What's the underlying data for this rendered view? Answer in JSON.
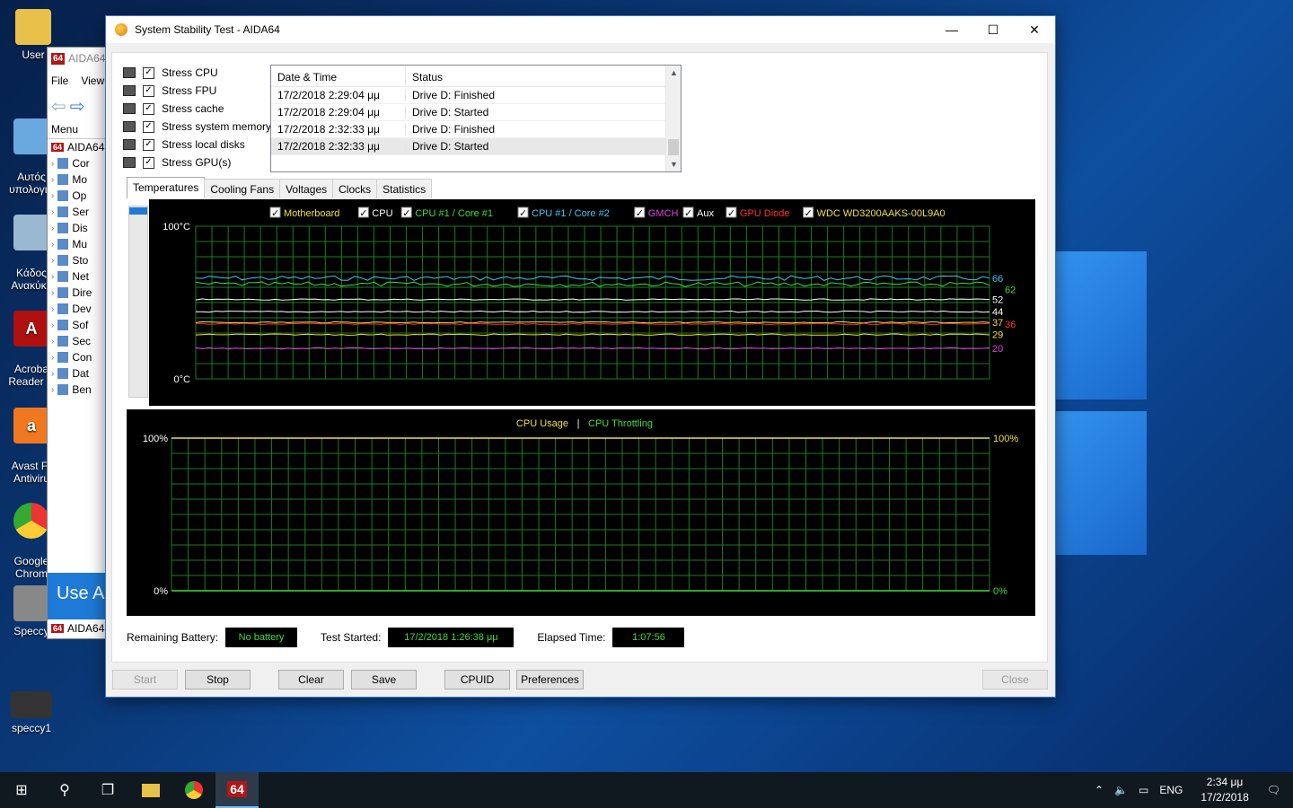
{
  "desktop": {
    "icons": [
      {
        "label": "User"
      },
      {
        "label": "Αυτός\nυπολογισ"
      },
      {
        "label": "Κάδος\nΑνακύκλ"
      },
      {
        "label": "Acroba\nReader D"
      },
      {
        "label": "Avast Fr\nAntiviru"
      },
      {
        "label": "Google\nChrom"
      },
      {
        "label": "Speccy"
      },
      {
        "label": "speccy1"
      }
    ]
  },
  "bg_window": {
    "title": "AIDA64",
    "menu": [
      "File",
      "View"
    ],
    "menu_tab": "Menu",
    "tree_root": "AIDA64",
    "tree_items": [
      "Cor",
      "Mo",
      "Op",
      "Ser",
      "Dis",
      "Mu",
      "Sto",
      "Net",
      "Dire",
      "Dev",
      "Sof",
      "Sec",
      "Con",
      "Dat",
      "Ben"
    ],
    "banner": "Use A",
    "taskbar_label": "AIDA64"
  },
  "window": {
    "title": "System Stability Test - AIDA64",
    "controls": {
      "minimize": "—",
      "maximize": "☐",
      "close": "✕"
    }
  },
  "stress": [
    {
      "label": "Stress CPU",
      "checked": true
    },
    {
      "label": "Stress FPU",
      "checked": true
    },
    {
      "label": "Stress cache",
      "checked": true
    },
    {
      "label": "Stress system memory",
      "checked": true
    },
    {
      "label": "Stress local disks",
      "checked": true
    },
    {
      "label": "Stress GPU(s)",
      "checked": true
    }
  ],
  "log": {
    "headers": [
      "Date & Time",
      "Status"
    ],
    "rows": [
      {
        "time": "17/2/2018 2:29:04 μμ",
        "status": "Drive D: Finished"
      },
      {
        "time": "17/2/2018 2:29:04 μμ",
        "status": "Drive D: Started"
      },
      {
        "time": "17/2/2018 2:32:33 μμ",
        "status": "Drive D: Finished"
      },
      {
        "time": "17/2/2018 2:32:33 μμ",
        "status": "Drive D: Started"
      }
    ]
  },
  "tabs": [
    "Temperatures",
    "Cooling Fans",
    "Voltages",
    "Clocks",
    "Statistics"
  ],
  "chart_data": [
    {
      "type": "line",
      "title": "",
      "legend": [
        {
          "name": "Motherboard",
          "color": "#f0e040"
        },
        {
          "name": "CPU",
          "color": "#ffffff"
        },
        {
          "name": "CPU #1 / Core #1",
          "color": "#3fdc3f"
        },
        {
          "name": "CPU #1 / Core #2",
          "color": "#40c8f0"
        },
        {
          "name": "GMCH",
          "color": "#e040e0"
        },
        {
          "name": "Aux",
          "color": "#ffffff"
        },
        {
          "name": "GPU Diode",
          "color": "#ff3030"
        },
        {
          "name": "WDC WD3200AAKS-00L9A0",
          "color": "#f0e040"
        }
      ],
      "ylim": [
        0,
        100
      ],
      "y_top_label": "100°C",
      "y_bottom_label": "0°C",
      "series": [
        {
          "name": "CPU #1 / Core #2",
          "value": 66,
          "color": "#40c8f0"
        },
        {
          "name": "CPU #1 / Core #1",
          "value": 62,
          "color": "#3fdc3f"
        },
        {
          "name": "CPU",
          "value": 52,
          "color": "#ffffff"
        },
        {
          "name": "Aux",
          "value": 44,
          "color": "#ffffff"
        },
        {
          "name": "WDC WD3200AAKS-00L9A0",
          "value": 37,
          "color": "#f0e040"
        },
        {
          "name": "GPU Diode",
          "value": 36,
          "color": "#ff3030"
        },
        {
          "name": "Motherboard",
          "value": 29,
          "color": "#f0e040"
        },
        {
          "name": "GMCH",
          "value": 20,
          "color": "#e040e0"
        }
      ],
      "grid": true
    },
    {
      "type": "line",
      "legend": [
        {
          "name": "CPU Usage",
          "color": "#f0e040"
        },
        {
          "name": "CPU Throttling",
          "color": "#3fdc3f"
        }
      ],
      "separator": "|",
      "ylim": [
        0,
        100
      ],
      "left_top_label": "100%",
      "left_bottom_label": "0%",
      "right_top_label": "100%",
      "right_bottom_label": "0%",
      "series": [
        {
          "name": "CPU Usage",
          "value": 100,
          "color": "#f0e040"
        },
        {
          "name": "CPU Throttling",
          "value": 0,
          "color": "#3fdc3f"
        }
      ],
      "grid": true
    }
  ],
  "status": {
    "battery_label": "Remaining Battery:",
    "battery_value": "No battery",
    "started_label": "Test Started:",
    "started_value": "17/2/2018 1:26:38 μμ",
    "elapsed_label": "Elapsed Time:",
    "elapsed_value": "1:07:56"
  },
  "buttons": {
    "start": "Start",
    "stop": "Stop",
    "clear": "Clear",
    "save": "Save",
    "cpuid": "CPUID",
    "preferences": "Preferences",
    "close": "Close"
  },
  "taskbar": {
    "language": "ENG",
    "time": "2:34 μμ",
    "date": "17/2/2018",
    "aida_label": "64"
  }
}
